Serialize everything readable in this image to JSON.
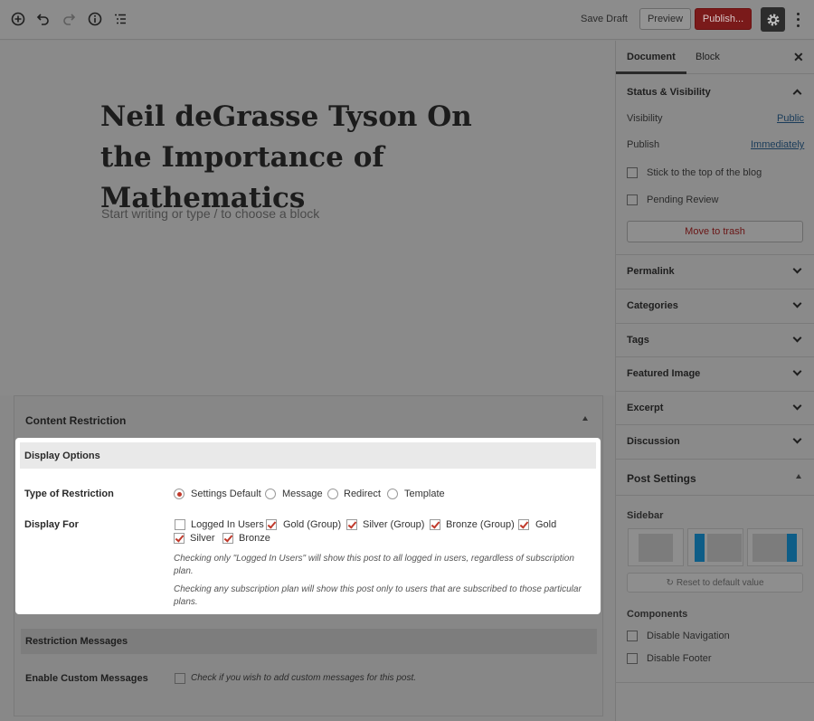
{
  "toolbar": {
    "icons": [
      "add-block-icon",
      "undo-icon",
      "redo-icon",
      "info-icon",
      "outline-icon"
    ],
    "save_draft": "Save Draft",
    "preview": "Preview",
    "publish": "Publish...",
    "settings_icon": "gear-icon",
    "more_icon": "more-vertical-icon"
  },
  "editor": {
    "title": "Neil deGrasse Tyson On the Importance of Mathematics",
    "block_placeholder": "Start writing or type / to choose a block"
  },
  "content_restriction": {
    "title": "Content Restriction",
    "display_options": {
      "header": "Display Options",
      "type_label": "Type of Restriction",
      "types": [
        {
          "label": "Settings Default",
          "checked": true
        },
        {
          "label": "Message",
          "checked": false
        },
        {
          "label": "Redirect",
          "checked": false
        },
        {
          "label": "Template",
          "checked": false
        }
      ],
      "display_for_label": "Display For",
      "display_for": [
        {
          "label": "Logged In Users",
          "checked": false
        },
        {
          "label": "Gold (Group)",
          "checked": true
        },
        {
          "label": "Silver (Group)",
          "checked": true
        },
        {
          "label": "Bronze (Group)",
          "checked": true
        },
        {
          "label": "Gold",
          "checked": true
        },
        {
          "label": "Silver",
          "checked": true
        },
        {
          "label": "Bronze",
          "checked": true
        }
      ],
      "note_1": "Checking only \"Logged In Users\" will show this post to all logged in users, regardless of subscription plan.",
      "note_2": "Checking any subscription plan will show this post only to users that are subscribed to those particular plans."
    },
    "restriction_messages": {
      "header": "Restriction Messages",
      "custom_label": "Enable Custom Messages",
      "custom_text": "Check if you wish to add custom messages for this post."
    }
  },
  "sidebar": {
    "tabs": [
      "Document",
      "Block"
    ],
    "active_tab": "Document",
    "status": {
      "title": "Status & Visibility",
      "visibility_label": "Visibility",
      "visibility_value": "Public",
      "publish_label": "Publish",
      "publish_value": "Immediately",
      "sticky_label": "Stick to the top of the blog",
      "pending_label": "Pending Review",
      "trash_label": "Move to trash"
    },
    "panels": [
      "Permalink",
      "Categories",
      "Tags",
      "Featured Image",
      "Excerpt",
      "Discussion"
    ],
    "post_settings": {
      "title": "Post Settings",
      "sidebar_label": "Sidebar",
      "reset_label": "Reset to default value",
      "components_label": "Components",
      "components": [
        "Disable Navigation",
        "Disable Footer"
      ]
    }
  }
}
